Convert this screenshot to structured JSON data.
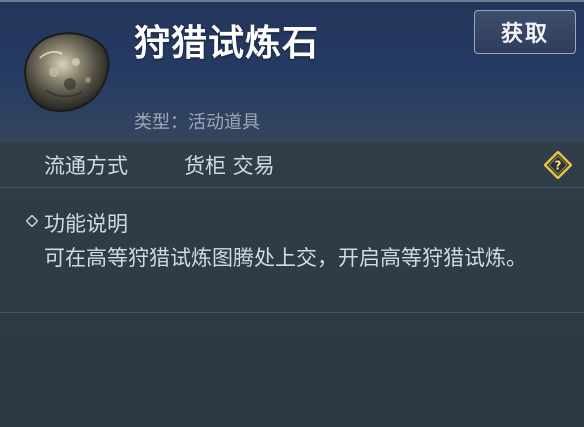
{
  "item": {
    "name": "狩猎试炼石",
    "type_label": "类型：活动道具",
    "icon": "stone-icon"
  },
  "actions": {
    "obtain_label": "获取"
  },
  "trade": {
    "label": "流通方式",
    "value": "货柜 交易",
    "help_icon": "question-diamond-icon"
  },
  "description": {
    "title": "功能说明",
    "text": "可在高等狩猎试炼图腾处上交，开启高等狩猎试炼。"
  },
  "colors": {
    "header_bg": "#253a63",
    "panel_bg": "#2f3d48",
    "title_text": "#ffffff",
    "body_text": "#d3d9df",
    "muted_text": "#9aa8b6",
    "help_icon_gold": "#e3c24a"
  }
}
